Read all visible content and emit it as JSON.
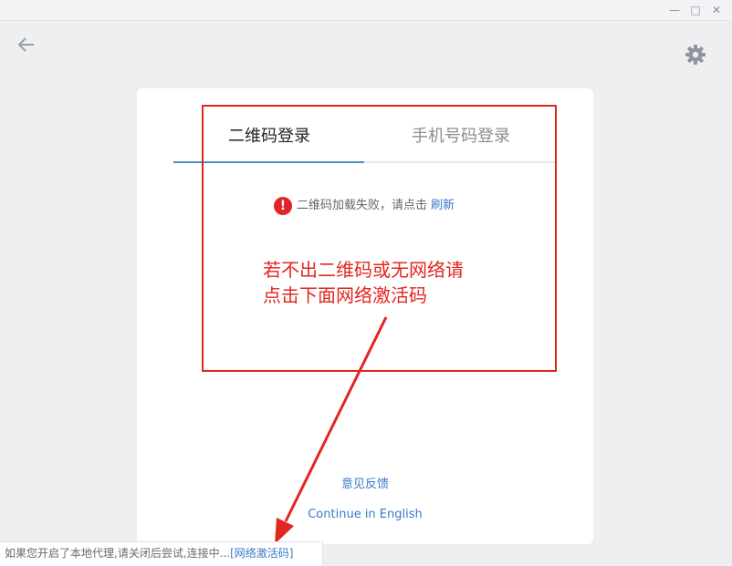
{
  "window": {
    "minimize_label": "—",
    "maximize_label": "□",
    "close_label": "✕"
  },
  "card": {
    "tabs": [
      {
        "label": "二维码登录",
        "active": true
      },
      {
        "label": "手机号码登录",
        "active": false
      }
    ],
    "qr_error": {
      "message": "二维码加载失败，请点击",
      "refresh_label": "刷新",
      "icon": "!"
    },
    "feedback_link": "意见反馈",
    "english_link": "Continue in English"
  },
  "annotation": {
    "line1": "若不出二维码或无网络请",
    "line2": "点击下面网络激活码",
    "color": "#e2261f"
  },
  "status_bar": {
    "text": "如果您开启了本地代理,请关闭后尝试,连接中...",
    "link_label": "[网络激活码]"
  },
  "colors": {
    "accent": "#3a78c8",
    "error": "#e0242b",
    "background": "#eeeff1"
  }
}
